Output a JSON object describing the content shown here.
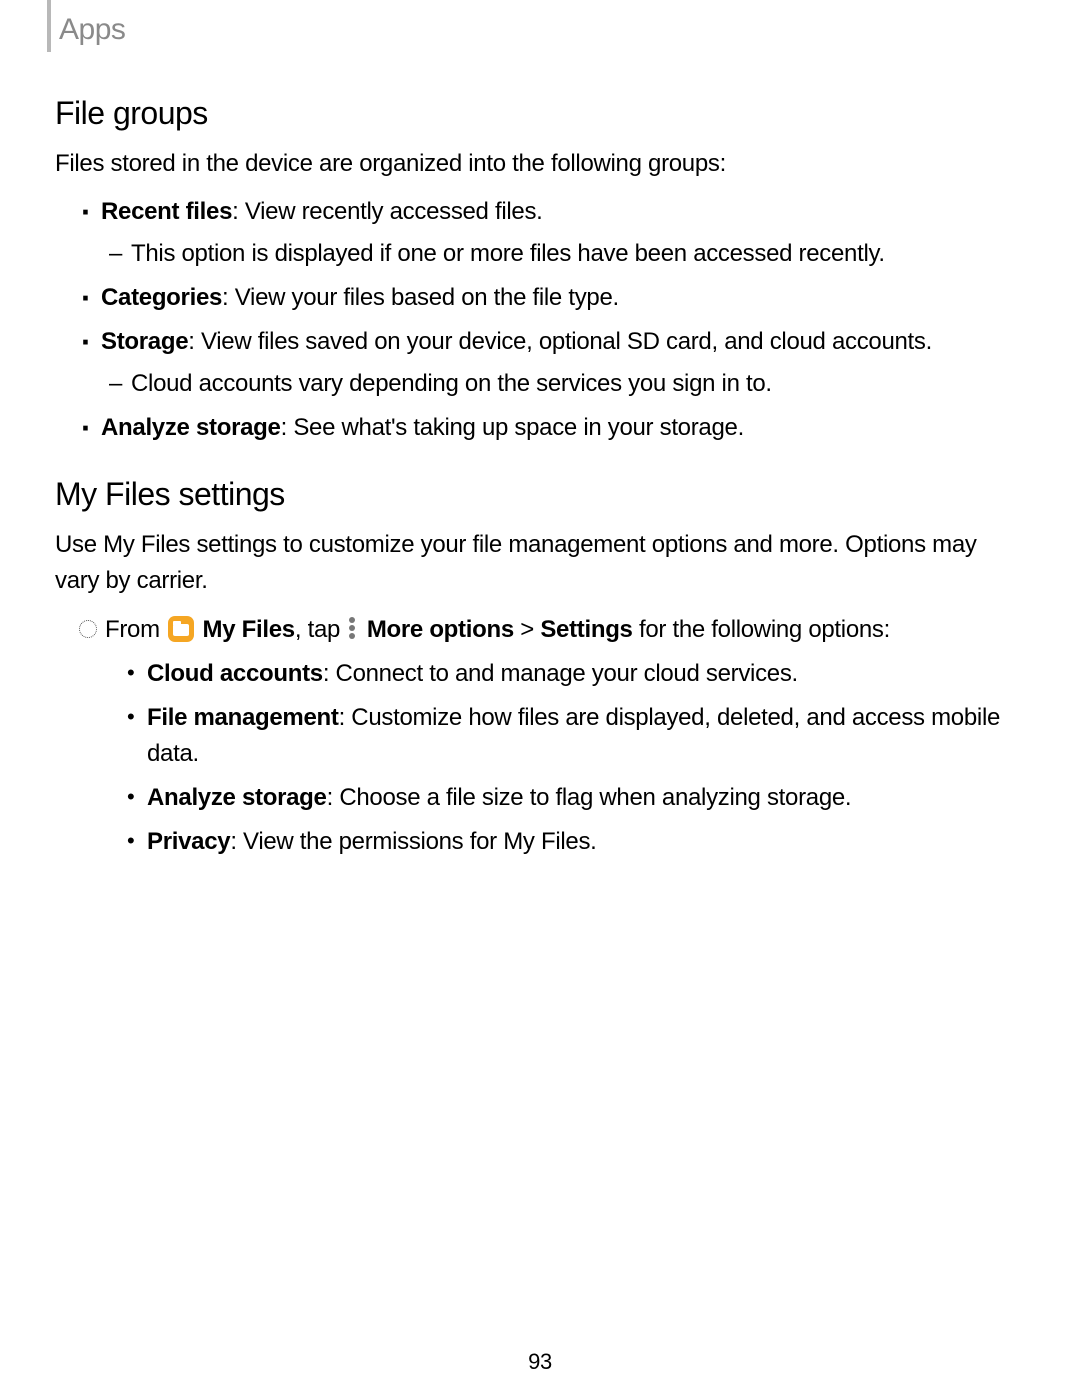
{
  "header": {
    "breadcrumb": "Apps"
  },
  "file_groups": {
    "title": "File groups",
    "intro": "Files stored in the device are organized into the following groups:",
    "items": [
      {
        "label": "Recent files",
        "desc": ": View recently accessed files.",
        "sub": [
          "This option is displayed if one or more files have been accessed recently."
        ]
      },
      {
        "label": "Categories",
        "desc": ": View your files based on the file type."
      },
      {
        "label": "Storage",
        "desc": ": View files saved on your device, optional SD card, and cloud accounts.",
        "sub": [
          "Cloud accounts vary depending on the services you sign in to."
        ]
      },
      {
        "label": "Analyze storage",
        "desc": ": See what's taking up space in your storage."
      }
    ]
  },
  "my_files_settings": {
    "title": "My Files settings",
    "intro": "Use My Files settings to customize your file management options and more. Options may vary by carrier.",
    "step": {
      "from": "From ",
      "app": "My Files",
      "tap": ", tap ",
      "more": "More options",
      "gt": " > ",
      "settings": "Settings",
      "tail": " for the following options:"
    },
    "options": [
      {
        "label": "Cloud accounts",
        "desc": ": Connect to and manage your cloud services."
      },
      {
        "label": "File management",
        "desc": ": Customize how files are displayed, deleted, and access mobile data."
      },
      {
        "label": "Analyze storage",
        "desc": ": Choose a file size to flag when analyzing storage."
      },
      {
        "label": "Privacy",
        "desc": ": View the permissions for My Files."
      }
    ]
  },
  "page_number": "93"
}
